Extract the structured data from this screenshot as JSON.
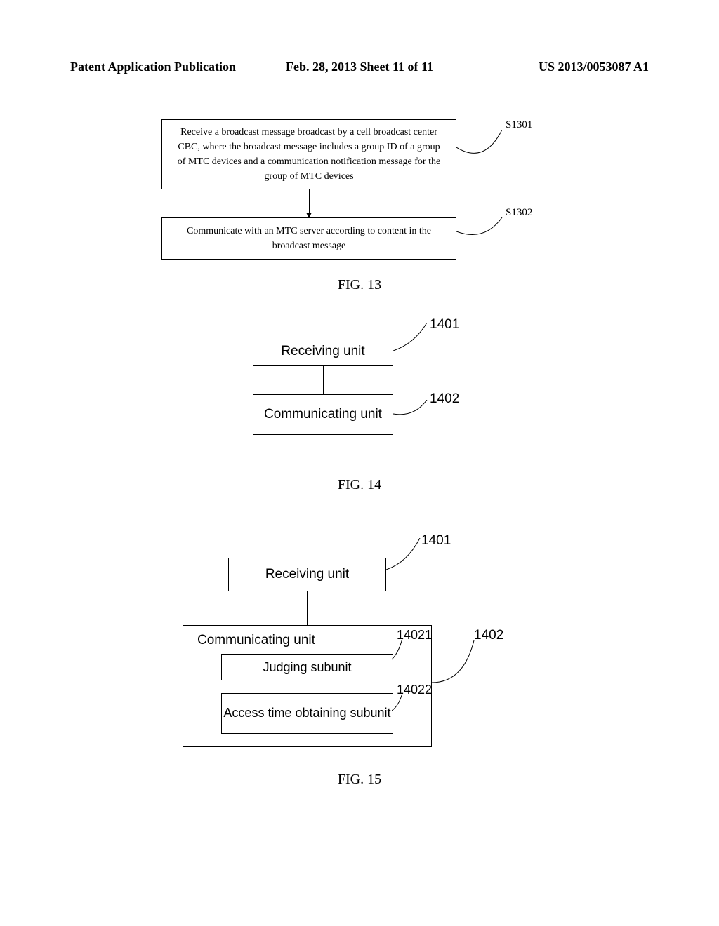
{
  "header": {
    "left": "Patent Application Publication",
    "center": "Feb. 28, 2013  Sheet 11 of 11",
    "right": "US 2013/0053087 A1"
  },
  "fig13": {
    "box1": "Receive a broadcast message broadcast by a cell broadcast center CBC, where the broadcast message includes a group ID of a group of MTC devices and a communication notification message for the group of MTC devices",
    "box2": "Communicate with an MTC server according to content in the broadcast message",
    "label1": "S1301",
    "label2": "S1302",
    "caption": "FIG. 13"
  },
  "fig14": {
    "receiving": "Receiving unit",
    "communicating": "Communicating unit",
    "label1401": "1401",
    "label1402": "1402",
    "caption": "FIG. 14"
  },
  "fig15": {
    "receiving": "Receiving unit",
    "communicating": "Communicating unit",
    "judging": "Judging subunit",
    "access": "Access time obtaining subunit",
    "label1401": "1401",
    "label1402": "1402",
    "label14021": "14021",
    "label14022": "14022",
    "caption": "FIG. 15"
  }
}
